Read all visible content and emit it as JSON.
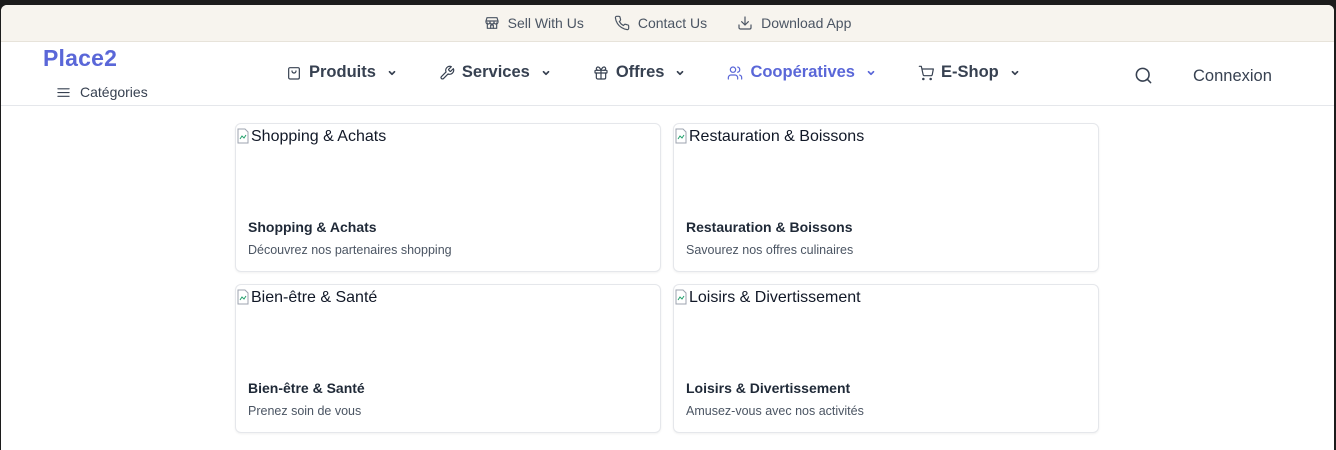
{
  "topbar": {
    "items": [
      {
        "label": "Sell With Us",
        "icon": "store-icon"
      },
      {
        "label": "Contact Us",
        "icon": "phone-icon"
      },
      {
        "label": "Download App",
        "icon": "download-icon"
      }
    ]
  },
  "header": {
    "logo": "Place2",
    "categories_label": "Catégories",
    "nav": [
      {
        "label": "Produits",
        "icon": "shopping-bag-icon",
        "active": false
      },
      {
        "label": "Services",
        "icon": "wrench-icon",
        "active": false
      },
      {
        "label": "Offres",
        "icon": "gift-icon",
        "active": false
      },
      {
        "label": "Coopératives",
        "icon": "users-icon",
        "active": true
      },
      {
        "label": "E-Shop",
        "icon": "cart-icon",
        "active": false
      }
    ],
    "login_label": "Connexion"
  },
  "cards": [
    {
      "image_alt": "Shopping & Achats",
      "title": "Shopping & Achats",
      "description": "Découvrez nos partenaires shopping"
    },
    {
      "image_alt": "Restauration & Boissons",
      "title": "Restauration & Boissons",
      "description": "Savourez nos offres culinaires"
    },
    {
      "image_alt": "Bien-être & Santé",
      "title": "Bien-être & Santé",
      "description": "Prenez soin de vous"
    },
    {
      "image_alt": "Loisirs & Divertissement",
      "title": "Loisirs & Divertissement",
      "description": "Amusez-vous avec nos activités"
    }
  ],
  "colors": {
    "accent": "#5a67d8",
    "topbar_bg": "#f7f4ee",
    "text": "#374151"
  }
}
